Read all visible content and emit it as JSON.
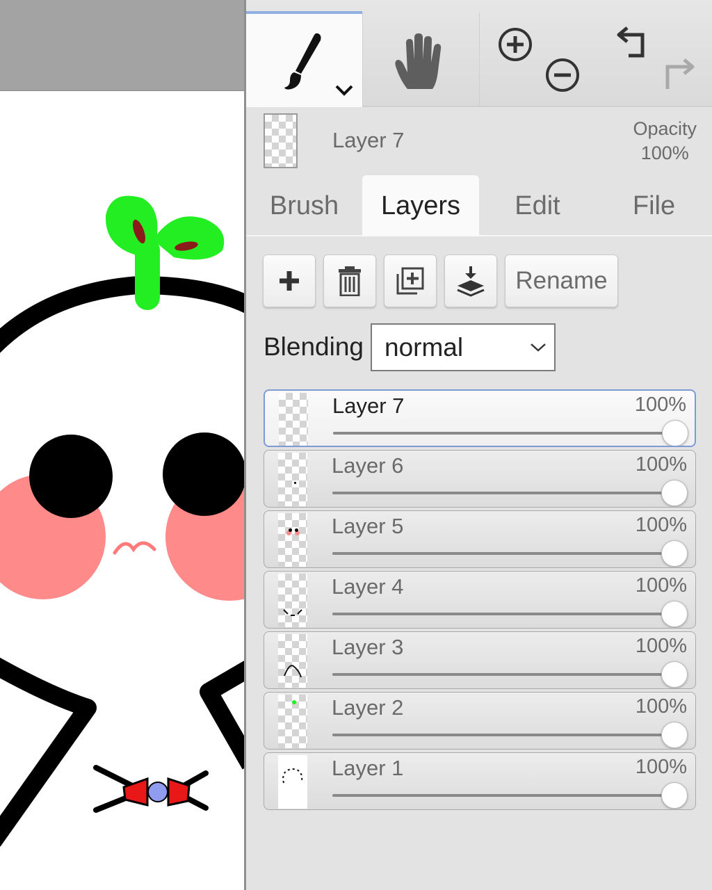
{
  "toolbar": {
    "active_tool": "brush",
    "tools": [
      "brush",
      "hand",
      "zoom",
      "history"
    ]
  },
  "current_layer": {
    "name": "Layer 7",
    "opacity_label": "Opacity",
    "opacity_value": "100%"
  },
  "tabs": [
    {
      "label": "Brush"
    },
    {
      "label": "Layers"
    },
    {
      "label": "Edit"
    },
    {
      "label": "File"
    }
  ],
  "active_tab": "Layers",
  "layer_buttons": {
    "rename_label": "Rename"
  },
  "blending": {
    "label": "Blending",
    "value": "normal"
  },
  "layers": [
    {
      "name": "Layer 7",
      "opacity": "100%",
      "opacity_fraction": 1.0,
      "selected": true
    },
    {
      "name": "Layer 6",
      "opacity": "100%",
      "opacity_fraction": 1.0,
      "selected": false
    },
    {
      "name": "Layer 5",
      "opacity": "100%",
      "opacity_fraction": 1.0,
      "selected": false
    },
    {
      "name": "Layer 4",
      "opacity": "100%",
      "opacity_fraction": 1.0,
      "selected": false
    },
    {
      "name": "Layer 3",
      "opacity": "100%",
      "opacity_fraction": 1.0,
      "selected": false
    },
    {
      "name": "Layer 2",
      "opacity": "100%",
      "opacity_fraction": 1.0,
      "selected": false
    },
    {
      "name": "Layer 1",
      "opacity": "100%",
      "opacity_fraction": 1.0,
      "selected": false
    }
  ],
  "colors": {
    "accent": "#7d9ad4",
    "sprout": "#22ee22",
    "blush": "#ff8a8a",
    "bow": "#e81818",
    "bow_center": "#8f9cf0"
  }
}
